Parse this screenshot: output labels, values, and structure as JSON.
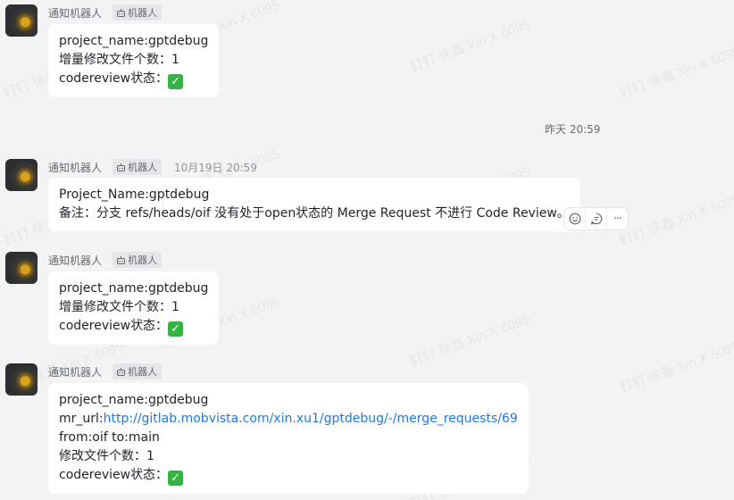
{
  "watermark": "钉钉 徐鑫 Xin X 6095",
  "time_divider": "昨天 20:59",
  "messages": [
    {
      "sender": "通知机器人",
      "tag": "机器人",
      "time": "",
      "lines": [
        "project_name:gptdebug",
        "增量修改文件个数：1",
        "codereview状态："
      ]
    },
    {
      "sender": "通知机器人",
      "tag": "机器人",
      "time": "10月19日 20:59",
      "lines": [
        "Project_Name:gptdebug",
        "备注：分支 refs/heads/oif 没有处于open状态的 Merge Request 不进行 Code Review。"
      ]
    },
    {
      "sender": "通知机器人",
      "tag": "机器人",
      "time": "",
      "lines": [
        "project_name:gptdebug",
        "增量修改文件个数：1",
        "codereview状态："
      ]
    },
    {
      "sender": "通知机器人",
      "tag": "机器人",
      "time": "",
      "lines": [
        "project_name:gptdebug",
        "mr_url:",
        "from:oif to:main",
        "修改文件个数：1",
        "codereview状态："
      ],
      "link": "http://gitlab.mobvista.com/xin.xu1/gptdebug/-/merge_requests/69"
    }
  ],
  "toolbar": {
    "icons": [
      "emoji-icon",
      "reply-icon",
      "more-icon"
    ],
    "more_label": "···"
  },
  "check_glyph": "✓"
}
